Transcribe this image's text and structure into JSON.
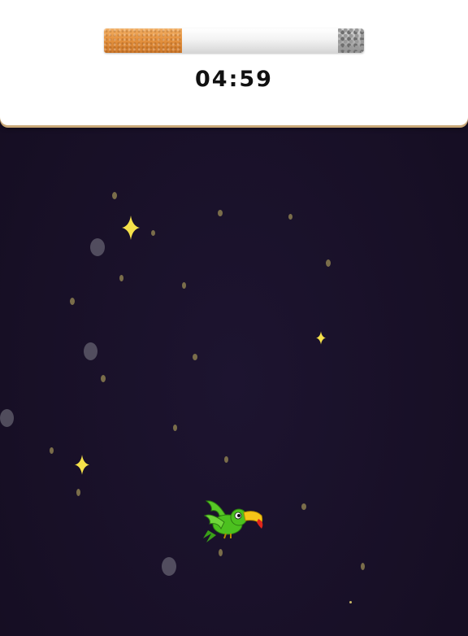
{
  "timer": {
    "text": "04:59",
    "cigarette_remaining_fraction": 0.9
  },
  "colors": {
    "background": "#1a1228",
    "filter": "#e5923f",
    "sparkle": "#f5e14a",
    "parrot_body": "#4cc11f",
    "beak": "#f5c518"
  },
  "player": {
    "icon": "parrot-icon"
  }
}
